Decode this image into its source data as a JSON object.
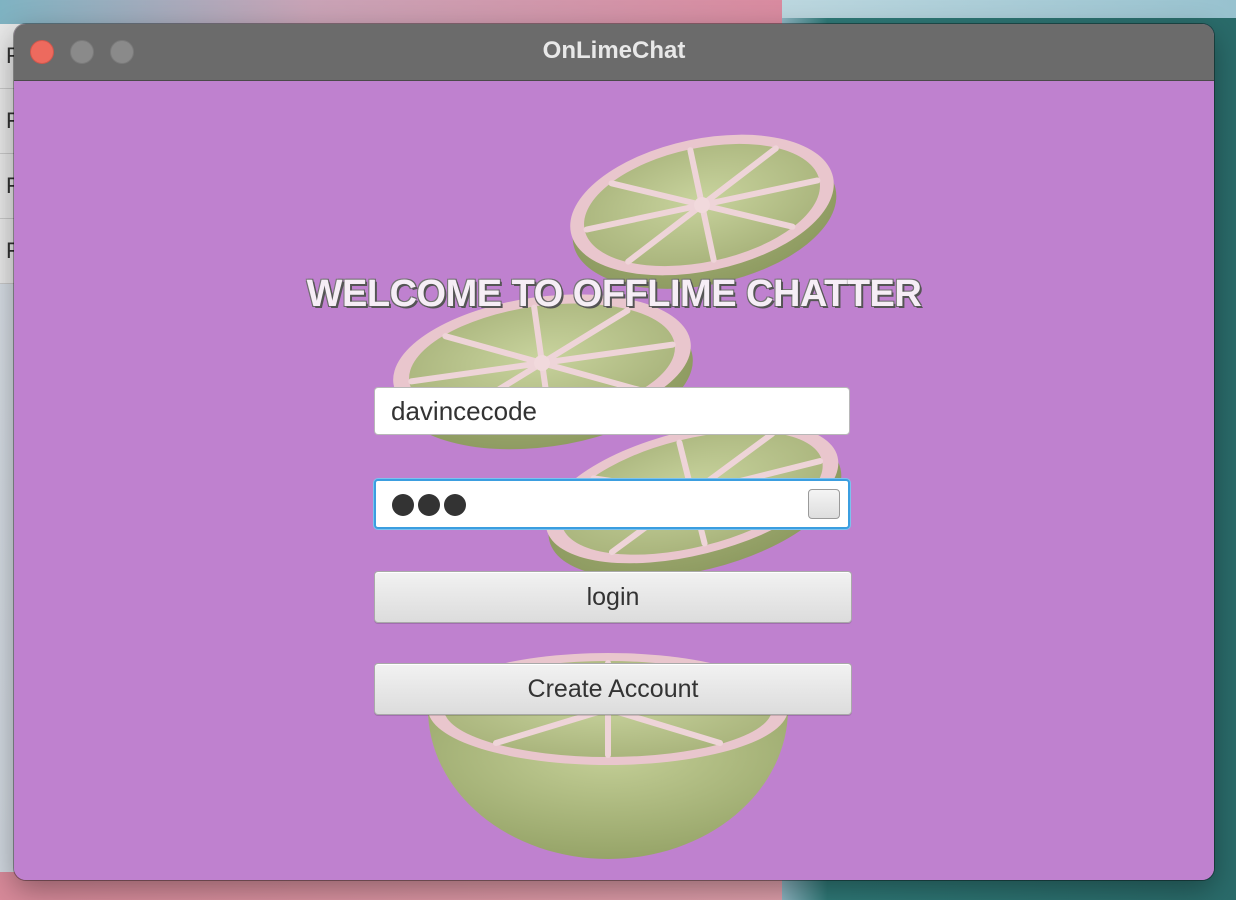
{
  "window": {
    "title": "OnLimeChat"
  },
  "background_panel": {
    "rows": [
      "F",
      "F",
      "F",
      "F"
    ]
  },
  "main": {
    "welcome_text": "WELCOME TO OFFLIME CHATTER",
    "username_value": "davincecode",
    "password_length": 3,
    "login_label": "login",
    "create_account_label": "Create Account"
  },
  "colors": {
    "window_background": "#bf81cf",
    "titlebar": "#6b6b6b",
    "close_button": "#ed6a5e",
    "focus_ring": "#3b9ee0",
    "lime_flesh": "#b9c68f",
    "lime_rind": "#eac7cf"
  },
  "icons": {
    "close": "close-traffic-light",
    "minimize": "minimize-traffic-light",
    "maximize": "maximize-traffic-light",
    "password_toggle": "show-password-toggle"
  }
}
